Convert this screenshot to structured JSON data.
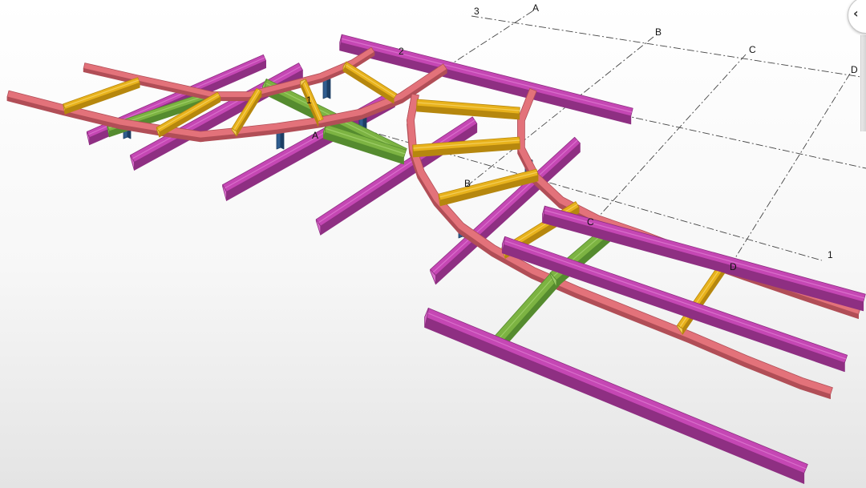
{
  "colors": {
    "primary_beam": "#c547b4",
    "primary_beam_light": "#d96fcb",
    "primary_beam_dark": "#8e2f82",
    "curved_beam": "#e3727a",
    "curved_beam_dark": "#b14e57",
    "brace": "#e8b21c",
    "brace_dark": "#b6870e",
    "green_beam": "#7cb342",
    "green_beam_dark": "#558b2f",
    "column": "#2f5d8f",
    "column_dark": "#1d3e64"
  },
  "grid": {
    "labels": [
      "3",
      "A",
      "B",
      "C",
      "D",
      "2",
      "1",
      "1",
      "A",
      "B",
      "C",
      "D"
    ]
  },
  "navigation": {
    "icon": "chevron-left-icon",
    "glyph": "‹"
  }
}
